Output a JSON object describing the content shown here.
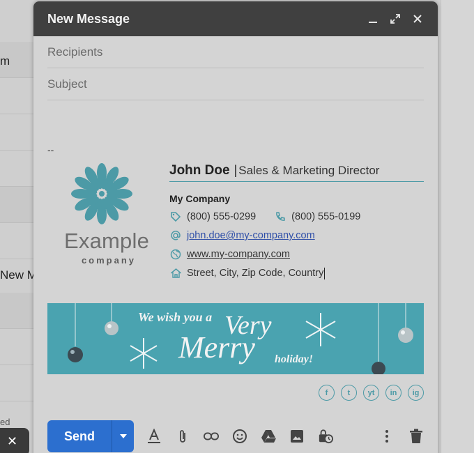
{
  "background": {
    "row_texts": [
      "m",
      "New M",
      "ed"
    ],
    "chip_close": "✕"
  },
  "compose": {
    "title": "New Message",
    "recipients_placeholder": "Recipients",
    "subject_placeholder": "Subject",
    "body_dash": "--"
  },
  "logo": {
    "name": "Example",
    "sub": "company"
  },
  "signature": {
    "name": "John Doe",
    "separator": "|",
    "role": "Sales & Marketing Director",
    "company": "My Company",
    "phone1": "(800) 555-0299",
    "phone2": "(800) 555-0199",
    "email": "john.doe@my-company.com",
    "website": "www.my-company.com",
    "address": "Street, City, Zip Code, Country"
  },
  "banner": {
    "line1": "We wish you a",
    "line2": "Very",
    "line3": "Merry",
    "line4": "holiday!"
  },
  "social": [
    "f",
    "t",
    "yt",
    "in",
    "ig"
  ],
  "toolbar": {
    "send_label": "Send",
    "icons": [
      "text-format-icon",
      "attach-icon",
      "link-icon",
      "emoji-icon",
      "drive-icon",
      "photo-icon",
      "lock-clock-icon"
    ]
  },
  "colors": {
    "accent": "#4c9aa6",
    "send": "#2c6fcf",
    "titlebar": "#404040",
    "banner": "#4aa3b0"
  }
}
